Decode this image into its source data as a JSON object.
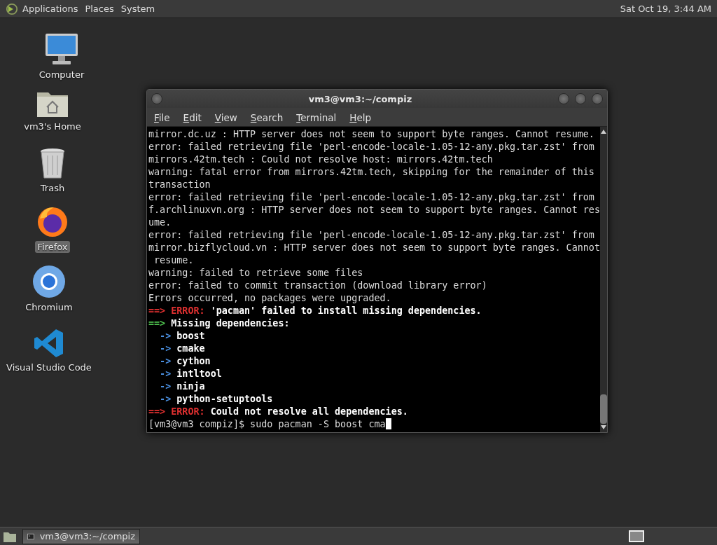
{
  "top_panel": {
    "menus": [
      "Applications",
      "Places",
      "System"
    ],
    "clock": "Sat Oct 19, 3:44 AM"
  },
  "desktop_icons": [
    {
      "label": "Computer",
      "kind": "computer",
      "selected": false
    },
    {
      "label": "vm3's Home",
      "kind": "home",
      "selected": false
    },
    {
      "label": "Trash",
      "kind": "trash",
      "selected": false
    },
    {
      "label": "Firefox",
      "kind": "firefox",
      "selected": true
    },
    {
      "label": "Chromium",
      "kind": "chromium",
      "selected": false
    },
    {
      "label": "Visual Studio Code",
      "kind": "vscode",
      "selected": false
    }
  ],
  "terminal_window": {
    "title": "vm3@vm3:~/compiz",
    "menu": [
      "File",
      "Edit",
      "View",
      "Search",
      "Terminal",
      "Help"
    ],
    "lines": [
      [
        {
          "text": "mirror.dc.uz : HTTP server does not seem to support byte ranges. Cannot resume.",
          "kind": "normal"
        }
      ],
      [
        {
          "text": "error: failed retrieving file 'perl-encode-locale-1.05-12-any.pkg.tar.zst' from",
          "kind": "normal"
        }
      ],
      [
        {
          "text": "mirrors.42tm.tech : Could not resolve host: mirrors.42tm.tech",
          "kind": "normal"
        }
      ],
      [
        {
          "text": "warning: fatal error from mirrors.42tm.tech, skipping for the remainder of this",
          "kind": "normal"
        }
      ],
      [
        {
          "text": "transaction",
          "kind": "normal"
        }
      ],
      [
        {
          "text": "error: failed retrieving file 'perl-encode-locale-1.05-12-any.pkg.tar.zst' from",
          "kind": "normal"
        }
      ],
      [
        {
          "text": "f.archlinuxvn.org : HTTP server does not seem to support byte ranges. Cannot res",
          "kind": "normal"
        }
      ],
      [
        {
          "text": "ume.",
          "kind": "normal"
        }
      ],
      [
        {
          "text": "error: failed retrieving file 'perl-encode-locale-1.05-12-any.pkg.tar.zst' from",
          "kind": "normal"
        }
      ],
      [
        {
          "text": "mirror.bizflycloud.vn : HTTP server does not seem to support byte ranges. Cannot",
          "kind": "normal"
        }
      ],
      [
        {
          "text": " resume.",
          "kind": "normal"
        }
      ],
      [
        {
          "text": "warning: failed to retrieve some files",
          "kind": "normal"
        }
      ],
      [
        {
          "text": "error: failed to commit transaction (download library error)",
          "kind": "normal"
        }
      ],
      [
        {
          "text": "Errors occurred, no packages were upgraded.",
          "kind": "normal"
        }
      ],
      [
        {
          "text": "==> ERROR: ",
          "kind": "red"
        },
        {
          "text": "'pacman' failed to install missing dependencies.",
          "kind": "bold"
        }
      ],
      [
        {
          "text": "==> ",
          "kind": "green"
        },
        {
          "text": "Missing dependencies:",
          "kind": "bold"
        }
      ],
      [
        {
          "text": "  -> ",
          "kind": "blue"
        },
        {
          "text": "boost",
          "kind": "bold"
        }
      ],
      [
        {
          "text": "  -> ",
          "kind": "blue"
        },
        {
          "text": "cmake",
          "kind": "bold"
        }
      ],
      [
        {
          "text": "  -> ",
          "kind": "blue"
        },
        {
          "text": "cython",
          "kind": "bold"
        }
      ],
      [
        {
          "text": "  -> ",
          "kind": "blue"
        },
        {
          "text": "intltool",
          "kind": "bold"
        }
      ],
      [
        {
          "text": "  -> ",
          "kind": "blue"
        },
        {
          "text": "ninja",
          "kind": "bold"
        }
      ],
      [
        {
          "text": "  -> ",
          "kind": "blue"
        },
        {
          "text": "python-setuptools",
          "kind": "bold"
        }
      ],
      [
        {
          "text": "==> ERROR: ",
          "kind": "red"
        },
        {
          "text": "Could not resolve all dependencies.",
          "kind": "bold"
        }
      ],
      [
        {
          "text": "[vm3@vm3 compiz]$ sudo pacman -S boost cma",
          "kind": "normal"
        }
      ]
    ]
  },
  "taskbar": {
    "tasks": [
      {
        "label": "vm3@vm3:~/compiz",
        "selected": true
      }
    ]
  }
}
